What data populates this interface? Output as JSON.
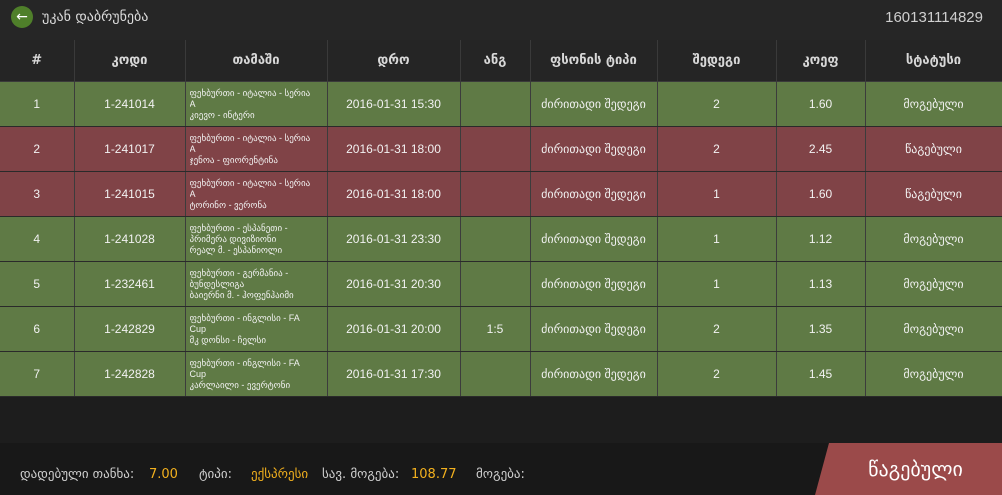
{
  "header": {
    "back_label": "უკან დაბრუნება",
    "ticket_id": "160131114829"
  },
  "table": {
    "columns": [
      "#",
      "კოდი",
      "თამაში",
      "დრო",
      "ანგ",
      "ფსონის ტიპი",
      "შედეგი",
      "კოეფ",
      "სტატუსი"
    ],
    "rows": [
      {
        "num": "1",
        "code": "1-241014",
        "game_line1": "ფეხბურთი - იტალია - სერია",
        "game_line2": "A",
        "game_line3": "კიევო - ინტერი",
        "time": "2016-01-31 15:30",
        "handicap": "",
        "bet_type": "ძირითადი შედეგი",
        "result": "2",
        "odds": "1.60",
        "status": "მოგებული",
        "state": "win"
      },
      {
        "num": "2",
        "code": "1-241017",
        "game_line1": "ფეხბურთი - იტალია - სერია",
        "game_line2": "A",
        "game_line3": "ჯენოა - ფიორენტინა",
        "time": "2016-01-31 18:00",
        "handicap": "",
        "bet_type": "ძირითადი შედეგი",
        "result": "2",
        "odds": "2.45",
        "status": "წაგებული",
        "state": "lost"
      },
      {
        "num": "3",
        "code": "1-241015",
        "game_line1": "ფეხბურთი - იტალია - სერია",
        "game_line2": "A",
        "game_line3": "ტორინო - ვერონა",
        "time": "2016-01-31 18:00",
        "handicap": "",
        "bet_type": "ძირითადი შედეგი",
        "result": "1",
        "odds": "1.60",
        "status": "წაგებული",
        "state": "lost"
      },
      {
        "num": "4",
        "code": "1-241028",
        "game_line1": "ფეხბურთი - ესპანეთი -",
        "game_line2": "პრიმერა დივიზიონი",
        "game_line3": "რეალ მ. - ესპანიოლი",
        "time": "2016-01-31 23:30",
        "handicap": "",
        "bet_type": "ძირითადი შედეგი",
        "result": "1",
        "odds": "1.12",
        "status": "მოგებული",
        "state": "win"
      },
      {
        "num": "5",
        "code": "1-232461",
        "game_line1": "ფეხბურთი - გერმანია -",
        "game_line2": "ბუნდესლიგა",
        "game_line3": "ბაიერნი მ. - ჰოფენჰაიმი",
        "time": "2016-01-31 20:30",
        "handicap": "",
        "bet_type": "ძირითადი შედეგი",
        "result": "1",
        "odds": "1.13",
        "status": "მოგებული",
        "state": "win"
      },
      {
        "num": "6",
        "code": "1-242829",
        "game_line1": "ფეხბურთი - ინგლისი - FA",
        "game_line2": "Cup",
        "game_line3": "მკ დონსი - ჩელსი",
        "time": "2016-01-31 20:00",
        "handicap": "1:5",
        "bet_type": "ძირითადი შედეგი",
        "result": "2",
        "odds": "1.35",
        "status": "მოგებული",
        "state": "win"
      },
      {
        "num": "7",
        "code": "1-242828",
        "game_line1": "ფეხბურთი - ინგლისი - FA",
        "game_line2": "Cup",
        "game_line3": "კარლაილი - ევერტონი",
        "time": "2016-01-31 17:30",
        "handicap": "",
        "bet_type": "ძირითადი შედეგი",
        "result": "2",
        "odds": "1.45",
        "status": "მოგებული",
        "state": "win"
      }
    ]
  },
  "footer": {
    "stake_label": "დადებული თანხა:",
    "stake_value": "7.00",
    "type_label": "ტიპი:",
    "type_value": "ექსპრესი",
    "potential_label": "სავ. მოგება:",
    "potential_value": "108.77",
    "win_label": "მოგება:",
    "win_value": "",
    "status_label": "წაგებული"
  },
  "colors": {
    "win_row": "#5f7a45",
    "lost_row": "#804347",
    "accent": "#f2b01e",
    "status_badge": "#9b4a4a",
    "back_icon": "#4f7f2a"
  },
  "icons": {
    "back": "arrow-left-icon"
  }
}
